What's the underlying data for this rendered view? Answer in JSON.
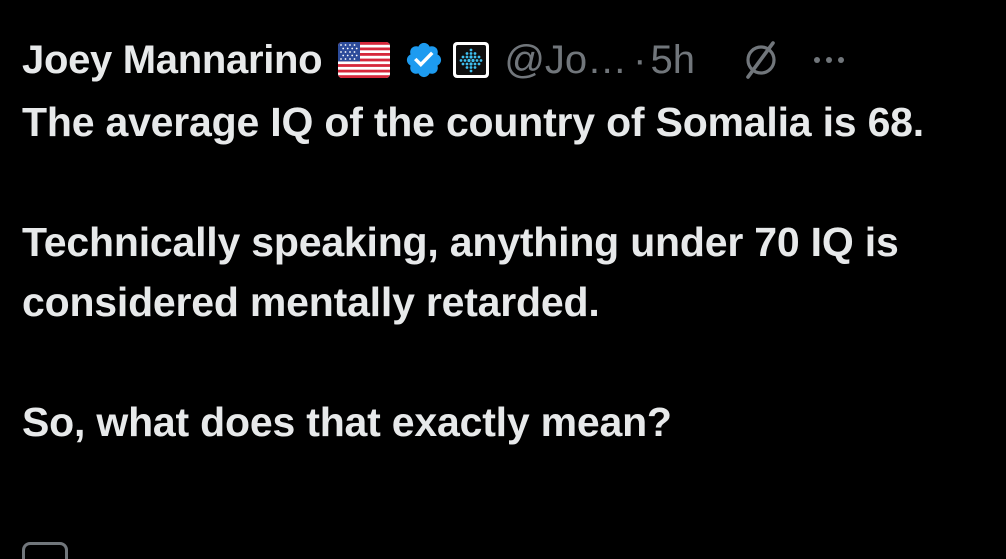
{
  "tweet": {
    "author_name": "Joey Mannarino",
    "handle": "@Jo…",
    "separator": "·",
    "time": "5h",
    "paragraphs": [
      "The average IQ of the country of Somalia is 68.",
      "Technically speaking, anything under 70 IQ is considered mentally retarded.",
      "So, what does that exactly mean?"
    ]
  },
  "icons": {
    "flag": "us-flag-icon",
    "verified": "verified-badge-icon",
    "affiliate": "affiliate-badge-icon",
    "grok": "grok-icon",
    "more": "more-options-icon"
  },
  "colors": {
    "background": "#000000",
    "text": "#e7e9ea",
    "secondary": "#71767b",
    "verified_blue": "#1d9bf0"
  }
}
